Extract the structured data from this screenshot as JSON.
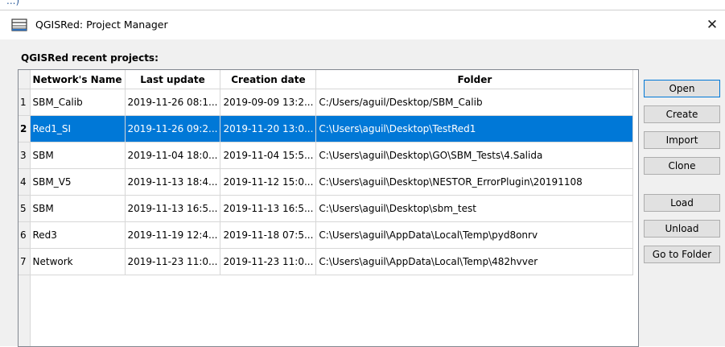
{
  "top_fragment": "...)",
  "window": {
    "title": "QGISRed: Project Manager",
    "close_glyph": "✕"
  },
  "section_label": "QGISRed recent projects:",
  "table": {
    "columns": [
      "Network's Name",
      "Last update",
      "Creation date",
      "Folder"
    ],
    "selected_row": 2,
    "rows": [
      {
        "n": "1",
        "name": "SBM_Calib",
        "last_update": "2019-11-26 08:1...",
        "created": "2019-09-09 13:2...",
        "folder": "C:/Users/aguil/Desktop/SBM_Calib"
      },
      {
        "n": "2",
        "name": "Red1_SI",
        "last_update": "2019-11-26 09:2...",
        "created": "2019-11-20 13:0...",
        "folder": "C:\\Users\\aguil\\Desktop\\TestRed1"
      },
      {
        "n": "3",
        "name": "SBM",
        "last_update": "2019-11-04 18:0...",
        "created": "2019-11-04 15:5...",
        "folder": "C:\\Users\\aguil\\Desktop\\GO\\SBM_Tests\\4.Salida"
      },
      {
        "n": "4",
        "name": "SBM_V5",
        "last_update": "2019-11-13 18:4...",
        "created": "2019-11-12 15:0...",
        "folder": "C:\\Users\\aguil\\Desktop\\NESTOR_ErrorPlugin\\20191108"
      },
      {
        "n": "5",
        "name": "SBM",
        "last_update": "2019-11-13 16:5...",
        "created": "2019-11-13 16:5...",
        "folder": "C:\\Users\\aguil\\Desktop\\sbm_test"
      },
      {
        "n": "6",
        "name": "Red3",
        "last_update": "2019-11-19 12:4...",
        "created": "2019-11-18 07:5...",
        "folder": "C:\\Users\\aguil\\AppData\\Local\\Temp\\pyd8onrv"
      },
      {
        "n": "7",
        "name": "Network",
        "last_update": "2019-11-23 11:0...",
        "created": "2019-11-23 11:0...",
        "folder": "C:\\Users\\aguil\\AppData\\Local\\Temp\\482hvver"
      }
    ]
  },
  "buttons": {
    "open": "Open",
    "create": "Create",
    "import": "Import",
    "clone": "Clone",
    "load": "Load",
    "unload": "Unload",
    "go_to_folder": "Go to Folder"
  },
  "colors": {
    "selection": "#0078d7",
    "dialog_bg": "#f0f0f0",
    "button_bg": "#e1e1e1"
  },
  "icons": {
    "app": "qgisred-table-icon",
    "close": "close-icon"
  }
}
